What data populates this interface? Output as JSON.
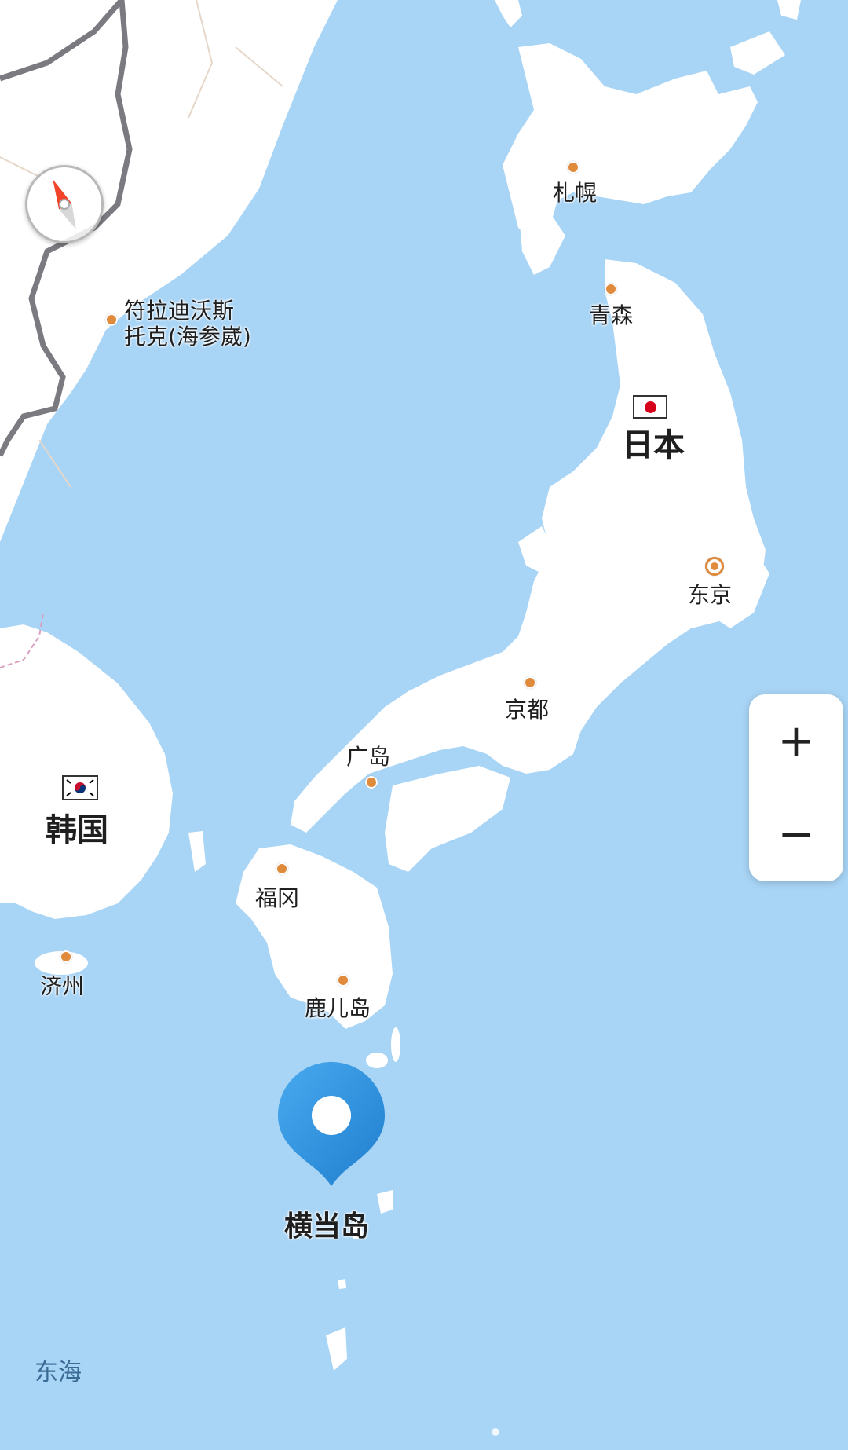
{
  "colors": {
    "sea": "#a8d4f5",
    "land": "#ffffff",
    "border": "#7a7a80",
    "city_dot": "#e08a3c",
    "pin": "#2e8fdc"
  },
  "map": {
    "cities": [
      {
        "id": "sapporo",
        "name": "札幌"
      },
      {
        "id": "aomori",
        "name": "青森"
      },
      {
        "id": "vladivostok",
        "name": "符拉迪沃斯托克(海参崴)",
        "lines": [
          "符拉迪沃斯",
          "托克(海参崴)"
        ]
      },
      {
        "id": "tokyo",
        "name": "东京",
        "capital": true
      },
      {
        "id": "kyoto",
        "name": "京都"
      },
      {
        "id": "hiroshima",
        "name": "广岛"
      },
      {
        "id": "fukuoka",
        "name": "福冈"
      },
      {
        "id": "kagoshima",
        "name": "鹿儿岛"
      },
      {
        "id": "jeju",
        "name": "济州"
      }
    ],
    "countries": [
      {
        "id": "japan",
        "name": "日本",
        "flag": "jp-flag-icon"
      },
      {
        "id": "korea",
        "name": "韩国",
        "flag": "kr-flag-icon"
      }
    ],
    "sea_label": "东海",
    "marker": {
      "name": "横当岛",
      "icon": "location-pin-icon"
    }
  },
  "controls": {
    "compass": {
      "icon": "compass-icon"
    },
    "zoom_in": {
      "label": "+",
      "icon": "plus-icon"
    },
    "zoom_out": {
      "label": "−",
      "icon": "minus-icon"
    }
  }
}
